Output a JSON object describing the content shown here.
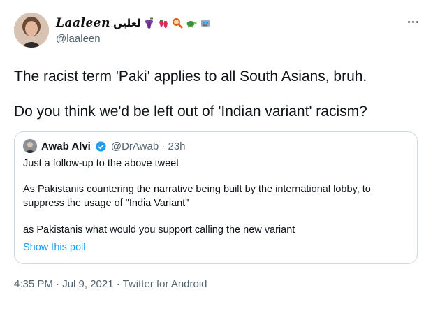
{
  "author": {
    "display_name": "Laaleen",
    "arabic_name": "لعلين",
    "handle": "@laaleen"
  },
  "tweet": {
    "line1": "The racist term 'Paki' applies to all South Asians, bruh.",
    "line2": "Do you think we'd be left out of 'Indian variant' racism?"
  },
  "quoted": {
    "name": "Awab Alvi",
    "handle_time": "@DrAwab · 23h",
    "lines": [
      "Just a follow-up to the above tweet",
      "As Pakistanis countering the narrative being built by the international lobby, to",
      "suppress the usage of \"India Variant\"",
      "as Pakistanis what would you support calling the new variant"
    ],
    "poll_link": "Show this poll"
  },
  "meta": {
    "timestamp": "4:35 PM · Jul 9, 2021 · Twitter for Android"
  },
  "colors": {
    "link": "#1d9bf0",
    "secondary_text": "#536471",
    "border": "#cfd9de"
  },
  "icons": [
    "grapes-icon",
    "strawberries-icon",
    "magnifier-icon",
    "turtle-icon",
    "robot-icon",
    "verified-badge-icon",
    "more-icon"
  ]
}
